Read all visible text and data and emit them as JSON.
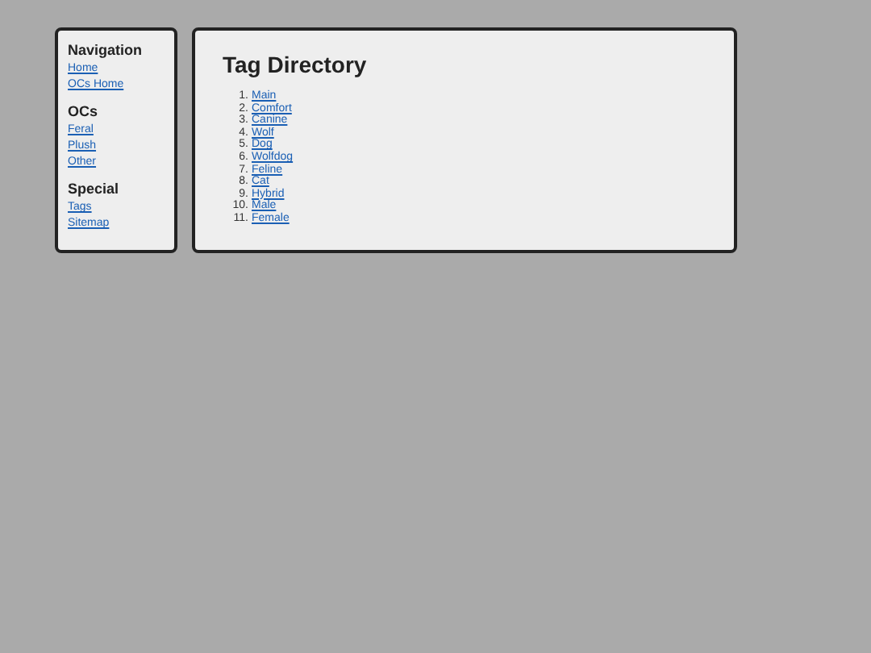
{
  "sidebar": {
    "sections": [
      {
        "heading": "Navigation",
        "links": [
          "Home",
          "OCs Home"
        ]
      },
      {
        "heading": "OCs",
        "links": [
          "Feral",
          "Plush",
          "Other"
        ]
      },
      {
        "heading": "Special",
        "links": [
          "Tags",
          "Sitemap"
        ]
      }
    ]
  },
  "main": {
    "title": "Tag Directory",
    "tags": [
      {
        "number": "1.",
        "label": "Main"
      },
      {
        "number": "2.",
        "label": "Comfort"
      },
      {
        "number": "3.",
        "label": "Canine"
      },
      {
        "number": "4.",
        "label": "Wolf"
      },
      {
        "number": "5.",
        "label": "Dog"
      },
      {
        "number": "6.",
        "label": "Wolfdog"
      },
      {
        "number": "7.",
        "label": "Feline"
      },
      {
        "number": "8.",
        "label": "Cat"
      },
      {
        "number": "9.",
        "label": "Hybrid"
      },
      {
        "number": "10.",
        "label": "Male"
      },
      {
        "number": "11.",
        "label": "Female"
      }
    ]
  }
}
